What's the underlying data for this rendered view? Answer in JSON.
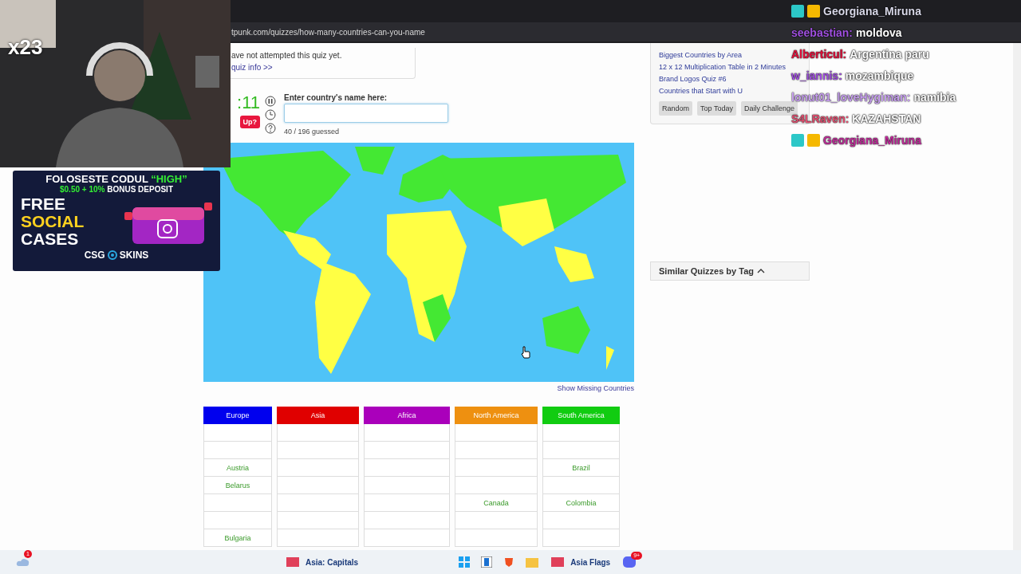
{
  "browser": {
    "url": "tpunk.com/quizzes/how-many-countries-can-you-name"
  },
  "quiz_info": {
    "status": "ave not attempted this quiz yet.",
    "link": "quiz info >>"
  },
  "timer": ":11",
  "give_up_button": "Up?",
  "answer": {
    "label": "Enter country's name here:"
  },
  "progress": "40 / 196 guessed",
  "show_missing_link": "Show Missing Countries",
  "continents": [
    {
      "name": "Europe",
      "color": "#0000ee",
      "cells": [
        {},
        {},
        {
          "text": "Austria"
        },
        {
          "text": "Belarus"
        },
        {},
        {},
        {
          "text": "Bulgaria"
        }
      ]
    },
    {
      "name": "Asia",
      "color": "#e00000",
      "cells": [
        {},
        {},
        {},
        {},
        {},
        {},
        {}
      ]
    },
    {
      "name": "Africa",
      "color": "#aa00bb",
      "cells": [
        {},
        {},
        {},
        {},
        {},
        {},
        {}
      ]
    },
    {
      "name": "North America",
      "color": "#ee9010",
      "cells": [
        {},
        {},
        {},
        {},
        {
          "text": "Canada"
        },
        {},
        {}
      ]
    },
    {
      "name": "South America",
      "color": "#11cc11",
      "cells": [
        {},
        {},
        {
          "text": "Brazil"
        },
        {},
        {
          "text": "Colombia"
        },
        {},
        {}
      ]
    }
  ],
  "sidebar": {
    "links": [
      "Biggest Countries by Area",
      "12 x 12 Multiplication Table in 2 Minutes",
      "Brand Logos Quiz #6",
      "Countries that Start with U"
    ],
    "buttons": [
      "Random",
      "Top Today",
      "Daily Challenge"
    ],
    "similar_tag": {
      "label": "Similar Quizzes by Tag",
      "expanded": true
    }
  },
  "webcam": {
    "counter": "x23"
  },
  "ad": {
    "headline": "FOLOSESTE CODUL",
    "code": "“HIGH”",
    "amount": "$0.50 + 10%",
    "offer": "BONUS DEPOSIT",
    "title_lines": [
      "FREE",
      "SOCIAL",
      "CASES"
    ],
    "brand_left": "CSG",
    "brand_right": "SKINS"
  },
  "chat": [
    {
      "user": "Georgiana_Miruna",
      "color": "#d8d8e8"
    },
    {
      "user": "seebastian:",
      "color": "#a050e0",
      "message": "moldova"
    },
    {
      "user": "Alberticul:",
      "color": "#e0103a",
      "message": "Argentina paru"
    },
    {
      "user": "w_iannis:",
      "color": "#a050e0",
      "message": "mozambique"
    },
    {
      "user": "lonut01_loveHygiman:",
      "color": "#c8a0f0",
      "message": "namibia"
    },
    {
      "user": "S4LRaven:",
      "color": "#e05070",
      "message": "KAZAHSTAN"
    },
    {
      "user": "Georgiana_Miruna",
      "color": "#c02a9a"
    }
  ],
  "taskbar": {
    "notification_badge": "1",
    "items": [
      "Asia: Capitals",
      "Asia Flags"
    ],
    "app_badge": "9+"
  }
}
